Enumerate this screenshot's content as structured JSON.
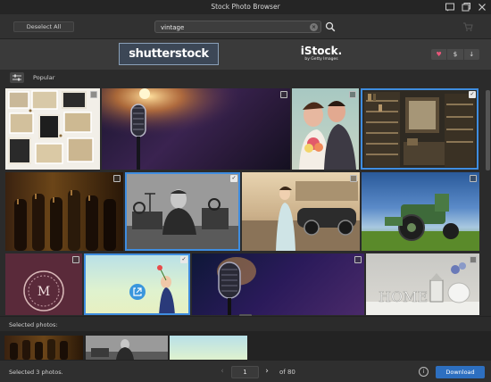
{
  "window": {
    "title": "Stock Photo Browser"
  },
  "toolbar": {
    "deselect_label": "Deselect All",
    "search_value": "vintage"
  },
  "providers": {
    "shutterstock_label": "shutterstock",
    "istock_name": "iStock.",
    "istock_sub": "by Getty Images",
    "actions": [
      "♥",
      "$",
      "↓"
    ],
    "heart_color": "#e8567a"
  },
  "popular": {
    "label": "Popular"
  },
  "grid": {
    "tiles": [
      {
        "subject": "collage of vintage photo frames",
        "selected": false
      },
      {
        "subject": "vintage microphone with stage light",
        "selected": false
      },
      {
        "subject": "retro wedding couple portrait",
        "selected": false
      },
      {
        "subject": "vintage bookshop interior",
        "selected": true
      },
      {
        "subject": "wine bottles in cellar",
        "selected": false
      },
      {
        "subject": "man at vintage radio",
        "selected": true
      },
      {
        "subject": "woman beside vintage car",
        "selected": false
      },
      {
        "subject": "vintage tractor in field",
        "selected": false
      },
      {
        "subject": "ornamental monogram M",
        "selected": false
      },
      {
        "subject": "child with flower against sky",
        "selected": true
      },
      {
        "subject": "vintage microphone close-up",
        "selected": false
      },
      {
        "subject": "HOME letters with lantern",
        "selected": false
      }
    ],
    "accent_color": "#3f8de0"
  },
  "selected_panel": {
    "label": "Selected photos:"
  },
  "footer": {
    "status": "Selected 3 photos.",
    "page_value": "1",
    "page_total": "of 80",
    "download_label": "Download",
    "download_color": "#2d6fc0"
  }
}
